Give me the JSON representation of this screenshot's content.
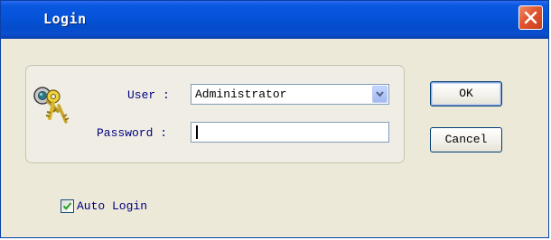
{
  "window": {
    "title": "Login",
    "close_icon": "close-icon"
  },
  "form": {
    "user_label": "User",
    "user_colon": ":",
    "user_value": "Administrator",
    "password_label": "Password",
    "password_colon": ":",
    "password_value": "",
    "auto_login_label": "Auto Login",
    "auto_login_checked": true
  },
  "buttons": {
    "ok_label": "OK",
    "cancel_label": "Cancel"
  },
  "colors": {
    "titlebar": "#0553d8",
    "label_text": "#000080",
    "close_button": "#e0552e",
    "dialog_background": "#ece9d8"
  },
  "icons": {
    "login": "keys-icon",
    "dropdown": "chevron-down-icon",
    "checkbox_mark": "checkmark-icon"
  }
}
